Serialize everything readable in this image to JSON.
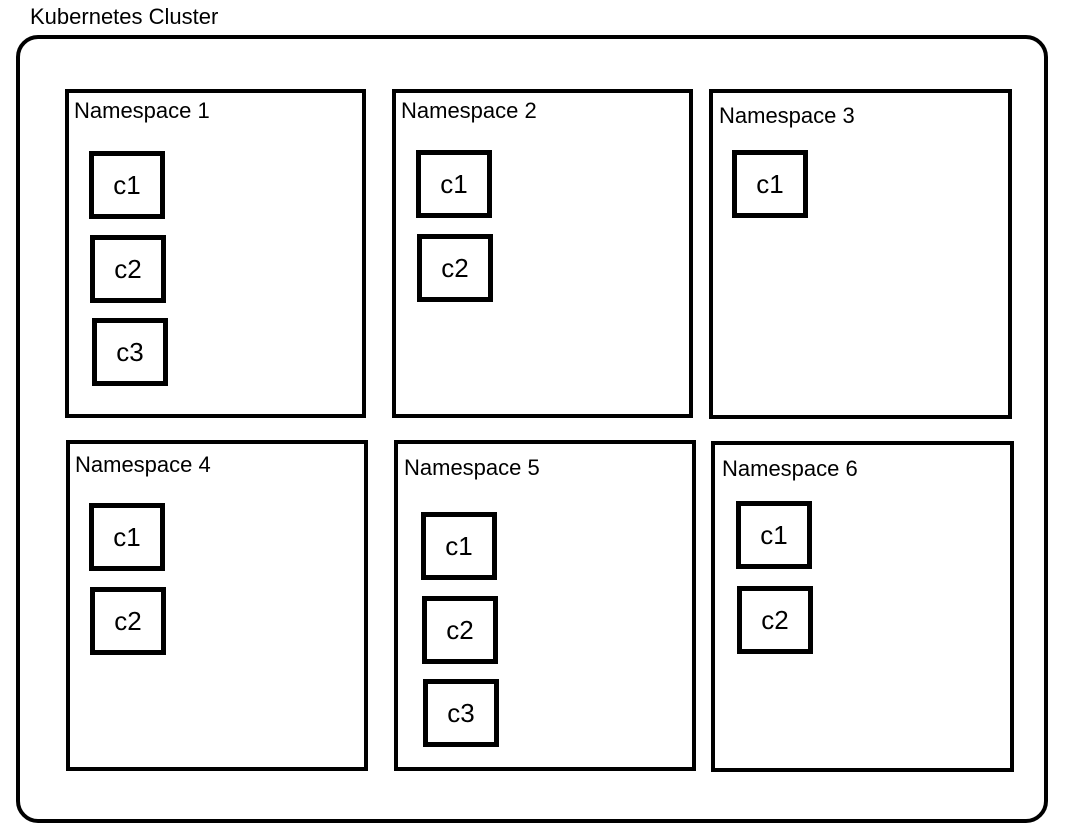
{
  "cluster": {
    "title": "Kubernetes Cluster"
  },
  "namespaces": [
    {
      "name": "Namespace 1",
      "containers": [
        "c1",
        "c2",
        "c3"
      ]
    },
    {
      "name": "Namespace 2",
      "containers": [
        "c1",
        "c2"
      ]
    },
    {
      "name": "Namespace 3",
      "containers": [
        "c1"
      ]
    },
    {
      "name": "Namespace 4",
      "containers": [
        "c1",
        "c2"
      ]
    },
    {
      "name": "Namespace 5",
      "containers": [
        "c1",
        "c2",
        "c3"
      ]
    },
    {
      "name": "Namespace 6",
      "containers": [
        "c1",
        "c2"
      ]
    }
  ]
}
